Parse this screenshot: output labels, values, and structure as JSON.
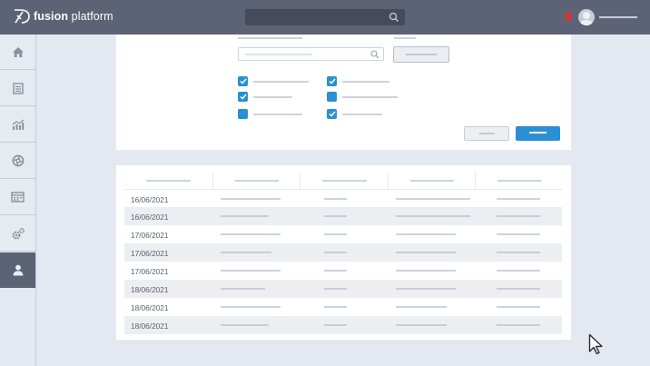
{
  "app": {
    "brand_bold": "fusion",
    "brand_light": " platform"
  },
  "header": {
    "search_icon": "search-icon",
    "notification_icon": "bell-icon",
    "notification_color": "#e0312b",
    "avatar_icon": "user-avatar"
  },
  "sidebar": {
    "items": [
      {
        "icon": "home-icon",
        "active": false
      },
      {
        "icon": "document-icon",
        "active": false
      },
      {
        "icon": "chart-icon",
        "active": false
      },
      {
        "icon": "aperture-icon",
        "active": false
      },
      {
        "icon": "calendar-icon",
        "active": false
      },
      {
        "icon": "settings-icon",
        "active": false
      },
      {
        "icon": "user-icon",
        "active": true
      }
    ]
  },
  "filters": {
    "checkboxes": [
      {
        "checked": true
      },
      {
        "checked": true
      },
      {
        "checked": false
      },
      {
        "checked": true
      },
      {
        "checked": false
      },
      {
        "checked": true
      }
    ]
  },
  "table": {
    "rows": [
      {
        "date": "16/06/2021"
      },
      {
        "date": "16/06/2021"
      },
      {
        "date": "17/06/2021"
      },
      {
        "date": "17/06/2021"
      },
      {
        "date": "17/06/2021"
      },
      {
        "date": "18/06/2021"
      },
      {
        "date": "18/06/2021"
      },
      {
        "date": "18/06/2021"
      }
    ]
  },
  "colors": {
    "topbar": "#5d6376",
    "accent": "#2b8fd3",
    "background": "#e4e9f1"
  }
}
